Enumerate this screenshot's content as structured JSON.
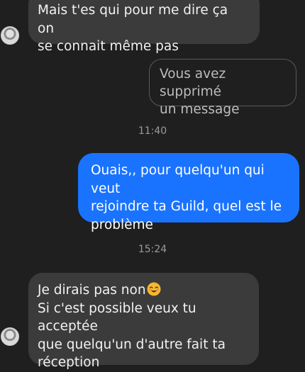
{
  "messages": {
    "incoming_1": "Mais t'es qui pour me dire ça on\nse connait même pas",
    "deleted_notice": "Vous avez supprimé\nun message",
    "timestamp_1": "11:40",
    "outgoing_1": "Ouais,, pour quelqu'un qui veut\nrejoindre ta Guild, quel est le\nproblème",
    "timestamp_2": "15:24",
    "incoming_2_line1": "Je dirais pas non",
    "incoming_2_emoji": "smiling-face-with-smiling-eyes-emoji",
    "incoming_2_rest": "Si c'est possible veux tu acceptée\nque quelqu'un d'autre fait ta\nréception"
  },
  "colors": {
    "background": "#1f1f1f",
    "incoming_bubble": "#3b3b3b",
    "outgoing_bubble": "#1a73ff",
    "timestamp": "#9a9a9a"
  }
}
